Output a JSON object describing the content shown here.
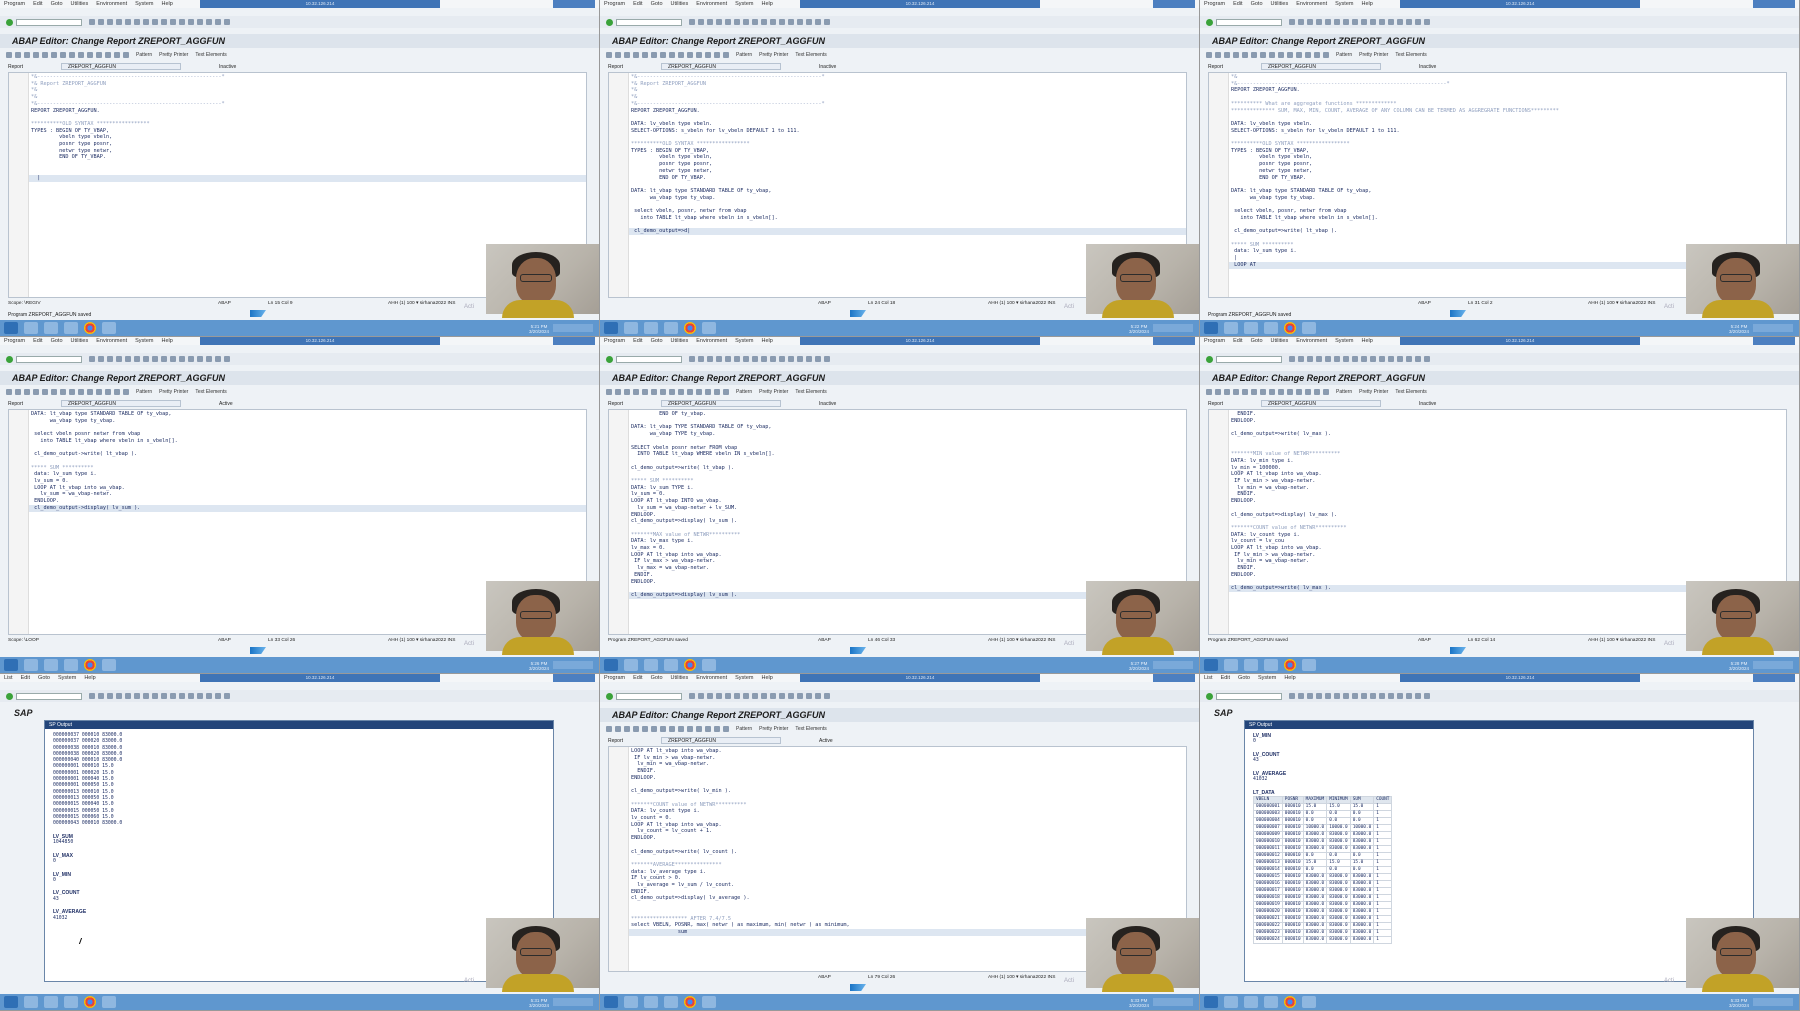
{
  "menus": {
    "editor": [
      "Program",
      "Edit",
      "Goto",
      "Utilities",
      "Environment",
      "System",
      "Help"
    ],
    "list": [
      "List",
      "Edit",
      "Goto",
      "System",
      "Help"
    ]
  },
  "remote_title": "10.32.126.214",
  "editor_title": "ABAP Editor: Change Report ZREPORT_AGGFUN",
  "toolbar2_labels": [
    "Pattern",
    "Pretty Printer",
    "Text Elements"
  ],
  "report_label": "Report",
  "report_name": "ZREPORT_AGGFUN",
  "sap_label": "SAP",
  "output_window_title": "SP Output",
  "activate_text": "Acti",
  "panels": [
    {
      "id": "p1",
      "status_inactive": "Inactive",
      "code": [
        {
          "t": "*&-----------------------------------------------------------*",
          "c": true
        },
        {
          "t": "*& Report ZREPORT_AGGFUN",
          "c": true
        },
        {
          "t": "*&",
          "c": true
        },
        {
          "t": "*&",
          "c": true
        },
        {
          "t": "*&-----------------------------------------------------------*",
          "c": true
        },
        {
          "t": "REPORT ZREPORT_AGGFUN."
        },
        {
          "t": ""
        },
        {
          "t": "**********OLD SYNTAX *****************",
          "c": true
        },
        {
          "t": "TYPES : BEGIN OF TY_VBAP,"
        },
        {
          "t": "         vbeln type vbeln,"
        },
        {
          "t": "         posnr type posnr,"
        },
        {
          "t": "         netwr type netwr,"
        },
        {
          "t": "         END OF TY_VBAP."
        },
        {
          "t": ""
        },
        {
          "t": ""
        },
        {
          "t": "  |"
        }
      ],
      "status_left": "Scope: \\REGIV",
      "status_mid": "ABAP",
      "status_pos": "Ln 15 Col  9",
      "status_right": "AHH (1) 100 ▾  sirhana2022  INS",
      "bottom_msg": "Program ZREPORT_AGGFUN saved",
      "clock": [
        "5:21 PM",
        "3/20/2024"
      ]
    },
    {
      "id": "p2",
      "status_inactive": "Inactive",
      "code": [
        {
          "t": "*&-----------------------------------------------------------*",
          "c": true
        },
        {
          "t": "*& Report ZREPORT_AGGFUN",
          "c": true
        },
        {
          "t": "*&",
          "c": true
        },
        {
          "t": "*&",
          "c": true
        },
        {
          "t": "*&-----------------------------------------------------------*",
          "c": true
        },
        {
          "t": "REPORT ZREPORT_AGGFUN."
        },
        {
          "t": ""
        },
        {
          "t": "DATA: lv_vbeln type vbeln."
        },
        {
          "t": "SELECT-OPTIONS: s_vbeln for lv_vbeln DEFAULT 1 to 111."
        },
        {
          "t": ""
        },
        {
          "t": "**********OLD SYNTAX *****************",
          "c": true
        },
        {
          "t": "TYPES : BEGIN OF TY_VBAP,"
        },
        {
          "t": "         vbeln type vbeln,"
        },
        {
          "t": "         posnr type posnr,"
        },
        {
          "t": "         netwr type netwr,"
        },
        {
          "t": "         END OF TY_VBAP."
        },
        {
          "t": ""
        },
        {
          "t": "DATA: lt_vbap type STANDARD TABLE OF ty_vbap,"
        },
        {
          "t": "      wa_vbap type ty_vbap."
        },
        {
          "t": ""
        },
        {
          "t": " select vbeln, posnr, netwr from vbap"
        },
        {
          "t": "   into TABLE lt_vbap where vbeln in s_vbeln[]."
        },
        {
          "t": ""
        },
        {
          "t": " cl_demo_output=>d|"
        }
      ],
      "status_left": "",
      "status_mid": "ABAP",
      "status_pos": "Ln 24 Col 18",
      "status_right": "AHH (1) 100 ▾  sirhana2022  INS",
      "bottom_msg": "",
      "clock": [
        "5:22 PM",
        "3/20/2024"
      ]
    },
    {
      "id": "p3",
      "status_inactive": "Inactive",
      "code": [
        {
          "t": "*&",
          "c": true
        },
        {
          "t": "*&-------------------------------------------------------------------*",
          "c": true
        },
        {
          "t": "REPORT ZREPORT_AGGFUN."
        },
        {
          "t": ""
        },
        {
          "t": "********** What are aggregate functions *************",
          "c": true
        },
        {
          "t": "************** SUM, MAX, MIN, COUNT, AVERAGE OF ANY COLUMN CAN BE TERMED AS AGGREGRATE FUNCTIONS*********",
          "c": true
        },
        {
          "t": ""
        },
        {
          "t": "DATA: lv_vbeln type vbeln."
        },
        {
          "t": "SELECT-OPTIONS: s_vbeln for lv_vbeln DEFAULT 1 to 111."
        },
        {
          "t": ""
        },
        {
          "t": "**********OLD SYNTAX *****************",
          "c": true
        },
        {
          "t": "TYPES : BEGIN OF TY_VBAP,"
        },
        {
          "t": "         vbeln type vbeln,"
        },
        {
          "t": "         posnr type posnr,"
        },
        {
          "t": "         netwr type netwr,"
        },
        {
          "t": "         END OF TY_VBAP."
        },
        {
          "t": ""
        },
        {
          "t": "DATA: lt_vbap type STANDARD TABLE OF ty_vbap,"
        },
        {
          "t": "      wa_vbap type ty_vbap."
        },
        {
          "t": ""
        },
        {
          "t": " select vbeln, posnr, netwr from vbap"
        },
        {
          "t": "   into TABLE lt_vbap where vbeln in s_vbeln[]."
        },
        {
          "t": ""
        },
        {
          "t": " cl_demo_output=>write( lt_vbap )."
        },
        {
          "t": ""
        },
        {
          "t": "***** SUM **********",
          "c": true
        },
        {
          "t": " data: lv_sum type i."
        },
        {
          "t": " |"
        },
        {
          "t": " LOOP AT"
        }
      ],
      "status_left": "",
      "status_mid": "ABAP",
      "status_pos": "Ln 31 Col  2",
      "status_right": "AHH (1) 100 ▾  sirhana2022  INS",
      "bottom_msg": "Program ZREPORT_AGGFUN saved",
      "clock": [
        "5:24 PM",
        "3/20/2024"
      ]
    },
    {
      "id": "p4",
      "status_inactive": "Active",
      "code": [
        {
          "t": "DATA: lt_vbap type STANDARD TABLE OF ty_vbap,"
        },
        {
          "t": "      wa_vbap type ty_vbap."
        },
        {
          "t": ""
        },
        {
          "t": " select vbeln posnr netwr from vbap"
        },
        {
          "t": "   into TABLE lt_vbap where vbeln in s_vbeln[]."
        },
        {
          "t": ""
        },
        {
          "t": " cl_demo_output->write( lt_vbap )."
        },
        {
          "t": ""
        },
        {
          "t": "***** SUM **********",
          "c": true
        },
        {
          "t": " data: lv_sum type i."
        },
        {
          "t": " lv_sum = 0."
        },
        {
          "t": " LOOP AT lt_vbap into wa_vbap."
        },
        {
          "t": "   lv_sum = wa_vbap-netwr."
        },
        {
          "t": " ENDLOOP."
        },
        {
          "t": " cl_demo_output->display( lv_sum )."
        }
      ],
      "status_left": "Scope: \\LOOP",
      "status_mid": "ABAP",
      "status_pos": "Ln 33 Col 26",
      "status_right": "AHH (1) 100 ▾  sirhana2022  INS",
      "bottom_msg": "",
      "clock": [
        "5:26 PM",
        "3/20/2024"
      ]
    },
    {
      "id": "p5",
      "status_inactive": "Inactive",
      "code": [
        {
          "t": "         END OF ty_vbap."
        },
        {
          "t": ""
        },
        {
          "t": "DATA: lt_vbap TYPE STANDARD TABLE OF ty_vbap,"
        },
        {
          "t": "      wa_vbap TYPE ty_vbap."
        },
        {
          "t": ""
        },
        {
          "t": "SELECT vbeln posnr netwr FROM vbap"
        },
        {
          "t": "  INTO TABLE lt_vbap WHERE vbeln IN s_vbeln[]."
        },
        {
          "t": ""
        },
        {
          "t": "cl_demo_output=>write( lt_vbap )."
        },
        {
          "t": ""
        },
        {
          "t": "***** SUM **********",
          "c": true
        },
        {
          "t": "DATA: lv_sum TYPE i."
        },
        {
          "t": "lv_sum = 0."
        },
        {
          "t": "LOOP AT lt_vbap INTO wa_vbap."
        },
        {
          "t": "  lv_sum = wa_vbap-netwr + lv_SUM."
        },
        {
          "t": "ENDLOOP."
        },
        {
          "t": "cl_demo_output=>display( lv_sum )."
        },
        {
          "t": ""
        },
        {
          "t": "*******MAX value of NETWR**********",
          "c": true
        },
        {
          "t": "DATA: lv_max type i."
        },
        {
          "t": "lv_max = 0."
        },
        {
          "t": "LOOP AT lt_vbap into wa_vbap."
        },
        {
          "t": " IF lv_max > wa_vbap-netwr."
        },
        {
          "t": "  lv_max = wa_vbap-netwr."
        },
        {
          "t": " ENDIF."
        },
        {
          "t": "ENDLOOP."
        },
        {
          "t": ""
        },
        {
          "t": "cl_demo_output=>display( lv_sum )."
        }
      ],
      "status_left": "Program ZREPORT_AGGFUN saved",
      "status_mid": "ABAP",
      "status_pos": "Ln 46 Col 33",
      "status_right": "AHH (1) 100 ▾  sirhana2022  INS",
      "bottom_msg": "",
      "clock": [
        "5:27 PM",
        "3/20/2024"
      ]
    },
    {
      "id": "p6",
      "status_inactive": "Inactive",
      "code": [
        {
          "t": "  ENDIF."
        },
        {
          "t": "ENDLOOP."
        },
        {
          "t": ""
        },
        {
          "t": "cl_demo_output=>write( lv_max )."
        },
        {
          "t": ""
        },
        {
          "t": ""
        },
        {
          "t": "*******MIN value of NETWR**********",
          "c": true
        },
        {
          "t": "DATA: lv_min type i."
        },
        {
          "t": "lv_min = 100000."
        },
        {
          "t": "LOOP AT lt_vbap into wa_vbap."
        },
        {
          "t": " IF lv_min > wa_vbap-netwr."
        },
        {
          "t": "  lv_min = wa_vbap-netwr."
        },
        {
          "t": "  ENDIF."
        },
        {
          "t": "ENDLOOP."
        },
        {
          "t": ""
        },
        {
          "t": "cl_demo_output=>display( lv_max )."
        },
        {
          "t": ""
        },
        {
          "t": "*******COUNT value of NETWR**********",
          "c": true
        },
        {
          "t": "DATA: lv_count type i."
        },
        {
          "t": "lv_count = lv_cou"
        },
        {
          "t": "LOOP AT lt_vbap into wa_vbap."
        },
        {
          "t": " IF lv_min > wa_vbap-netwr."
        },
        {
          "t": "  lv_min = wa_vbap-netwr."
        },
        {
          "t": "  ENDIF."
        },
        {
          "t": "ENDLOOP."
        },
        {
          "t": ""
        },
        {
          "t": "cl_demo_output=>write( lv_max )."
        }
      ],
      "status_left": "Program ZREPORT_AGGFUN saved",
      "status_mid": "ABAP",
      "status_pos": "Ln 62 Col 14",
      "status_right": "AHH (1) 100 ▾  sirhana2022  INS",
      "bottom_msg": "",
      "clock": [
        "5:28 PM",
        "3/20/2024"
      ]
    },
    {
      "id": "p7",
      "output_rows": [
        "000000037 000010 83000.0",
        "000000037 000020 83000.0",
        "000000038 000010 83000.0",
        "000000038 000020 83000.0",
        "000000040 000010 83000.0",
        "000000001 000010 15.0",
        "000000001 000020 15.0",
        "000000001 000040 15.0",
        "000000001 000050 15.0",
        "000000013 000010 15.0",
        "000000013 000050 15.0",
        "000000015 000040 15.0",
        "000000015 000050 15.0",
        "000000015 000060 15.0",
        "000000043 000010 83000.0"
      ],
      "vars": [
        {
          "label": "LV_SUM",
          "value": "1044850"
        },
        {
          "label": "LV_MAX",
          "value": "0"
        },
        {
          "label": "LV_MIN",
          "value": "0"
        },
        {
          "label": "LV_COUNT",
          "value": "43"
        },
        {
          "label": "LV_AVERAGE",
          "value": "41032"
        }
      ],
      "clock": [
        "5:31 PM",
        "3/20/2024"
      ]
    },
    {
      "id": "p8",
      "status_inactive": "Active",
      "code": [
        {
          "t": "LOOP AT lt_vbap into wa_vbap."
        },
        {
          "t": " IF lv_min > wa_vbap-netwr."
        },
        {
          "t": "  lv_min = wa_vbap-netwr."
        },
        {
          "t": "  ENDIF."
        },
        {
          "t": "ENDLOOP."
        },
        {
          "t": ""
        },
        {
          "t": "cl_demo_output=>write( lv_min )."
        },
        {
          "t": ""
        },
        {
          "t": "*******COUNT value of NETWR**********",
          "c": true
        },
        {
          "t": "DATA: lv_count type i."
        },
        {
          "t": "lv_count = 0."
        },
        {
          "t": "LOOP AT lt_vbap into wa_vbap."
        },
        {
          "t": "  lv_count = lv_count + 1."
        },
        {
          "t": "ENDLOOP."
        },
        {
          "t": ""
        },
        {
          "t": "cl_demo_output=>write( lv_count )."
        },
        {
          "t": ""
        },
        {
          "t": "*******AVERAGE***************",
          "c": true
        },
        {
          "t": "data: lv_average type i."
        },
        {
          "t": "IF lv_count > 0."
        },
        {
          "t": "  lv_average = lv_sum / lv_count."
        },
        {
          "t": "ENDIF."
        },
        {
          "t": "cl_demo_output=>display( lv_average )."
        },
        {
          "t": ""
        },
        {
          "t": ""
        },
        {
          "t": "****************** AFTER 7.4/7.5",
          "c": true
        },
        {
          "t": "select VBELN, POSNR, max( netwr ) as maximum, min( netwr ) as minimum,"
        },
        {
          "t": "               sum"
        }
      ],
      "status_left": "",
      "status_mid": "ABAP",
      "status_pos": "Ln 79 Col 26",
      "status_right": "AHH (1) 100 ▾  sirhana2022  INS",
      "bottom_msg": "",
      "clock": [
        "5:33 PM",
        "3/20/2024"
      ]
    },
    {
      "id": "p9",
      "vars": [
        {
          "label": "LV_MIN",
          "value": "0"
        },
        {
          "label": "LV_COUNT",
          "value": "43"
        },
        {
          "label": "LV_AVERAGE",
          "value": "41032"
        }
      ],
      "table_title": "LT_DATA",
      "table_headers": [
        "VBELN",
        "POSNR",
        "MAXIMUM",
        "MINIMUM",
        "SUM",
        "COUNT"
      ],
      "table_rows": [
        [
          "000000001",
          "000010",
          "15.0",
          "15.0",
          "15.0",
          "1"
        ],
        [
          "000000003",
          "000010",
          "0.0",
          "0.0",
          "0.0",
          "1"
        ],
        [
          "000000004",
          "000010",
          "0.0",
          "0.0",
          "0.0",
          "1"
        ],
        [
          "000000007",
          "000010",
          "10000.0",
          "10000.0",
          "10000.0",
          "1"
        ],
        [
          "000000009",
          "000010",
          "83000.0",
          "83000.0",
          "83000.0",
          "1"
        ],
        [
          "000000010",
          "000010",
          "83000.0",
          "83000.0",
          "83000.0",
          "1"
        ],
        [
          "000000011",
          "000010",
          "83000.0",
          "83000.0",
          "83000.0",
          "1"
        ],
        [
          "000000012",
          "000010",
          "0.0",
          "0.0",
          "0.0",
          "1"
        ],
        [
          "000000013",
          "000010",
          "15.0",
          "15.0",
          "15.0",
          "1"
        ],
        [
          "000000014",
          "000010",
          "0.0",
          "0.0",
          "0.0",
          "1"
        ],
        [
          "000000015",
          "000010",
          "83000.0",
          "83000.0",
          "83000.0",
          "1"
        ],
        [
          "000000016",
          "000010",
          "83000.0",
          "83000.0",
          "83000.0",
          "1"
        ],
        [
          "000000017",
          "000010",
          "83000.0",
          "83000.0",
          "83000.0",
          "1"
        ],
        [
          "000000018",
          "000010",
          "83000.0",
          "83000.0",
          "83000.0",
          "1"
        ],
        [
          "000000019",
          "000010",
          "83000.0",
          "83000.0",
          "83000.0",
          "1"
        ],
        [
          "000000020",
          "000010",
          "83000.0",
          "83000.0",
          "83000.0",
          "1"
        ],
        [
          "000000021",
          "000010",
          "83000.0",
          "83000.0",
          "83000.0",
          "1"
        ],
        [
          "000000022",
          "000010",
          "83000.0",
          "83000.0",
          "83000.0",
          "1"
        ],
        [
          "000000023",
          "000010",
          "83000.0",
          "83000.0",
          "83000.0",
          "1"
        ],
        [
          "000000024",
          "000010",
          "83000.0",
          "83000.0",
          "83000.0",
          "1"
        ]
      ],
      "clock": [
        "5:33 PM",
        "3/20/2024"
      ]
    }
  ]
}
